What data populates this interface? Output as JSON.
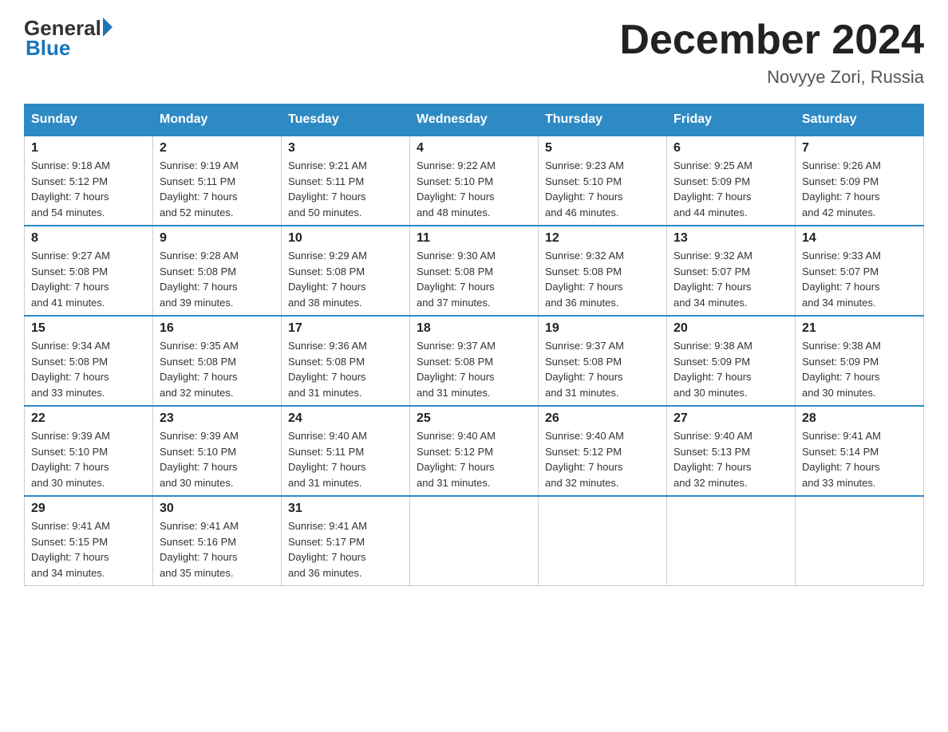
{
  "logo": {
    "general": "General",
    "blue": "Blue"
  },
  "title": "December 2024",
  "location": "Novyye Zori, Russia",
  "days_of_week": [
    "Sunday",
    "Monday",
    "Tuesday",
    "Wednesday",
    "Thursday",
    "Friday",
    "Saturday"
  ],
  "weeks": [
    [
      {
        "day": "1",
        "sunrise": "9:18 AM",
        "sunset": "5:12 PM",
        "daylight": "7 hours and 54 minutes."
      },
      {
        "day": "2",
        "sunrise": "9:19 AM",
        "sunset": "5:11 PM",
        "daylight": "7 hours and 52 minutes."
      },
      {
        "day": "3",
        "sunrise": "9:21 AM",
        "sunset": "5:11 PM",
        "daylight": "7 hours and 50 minutes."
      },
      {
        "day": "4",
        "sunrise": "9:22 AM",
        "sunset": "5:10 PM",
        "daylight": "7 hours and 48 minutes."
      },
      {
        "day": "5",
        "sunrise": "9:23 AM",
        "sunset": "5:10 PM",
        "daylight": "7 hours and 46 minutes."
      },
      {
        "day": "6",
        "sunrise": "9:25 AM",
        "sunset": "5:09 PM",
        "daylight": "7 hours and 44 minutes."
      },
      {
        "day": "7",
        "sunrise": "9:26 AM",
        "sunset": "5:09 PM",
        "daylight": "7 hours and 42 minutes."
      }
    ],
    [
      {
        "day": "8",
        "sunrise": "9:27 AM",
        "sunset": "5:08 PM",
        "daylight": "7 hours and 41 minutes."
      },
      {
        "day": "9",
        "sunrise": "9:28 AM",
        "sunset": "5:08 PM",
        "daylight": "7 hours and 39 minutes."
      },
      {
        "day": "10",
        "sunrise": "9:29 AM",
        "sunset": "5:08 PM",
        "daylight": "7 hours and 38 minutes."
      },
      {
        "day": "11",
        "sunrise": "9:30 AM",
        "sunset": "5:08 PM",
        "daylight": "7 hours and 37 minutes."
      },
      {
        "day": "12",
        "sunrise": "9:32 AM",
        "sunset": "5:08 PM",
        "daylight": "7 hours and 36 minutes."
      },
      {
        "day": "13",
        "sunrise": "9:32 AM",
        "sunset": "5:07 PM",
        "daylight": "7 hours and 34 minutes."
      },
      {
        "day": "14",
        "sunrise": "9:33 AM",
        "sunset": "5:07 PM",
        "daylight": "7 hours and 34 minutes."
      }
    ],
    [
      {
        "day": "15",
        "sunrise": "9:34 AM",
        "sunset": "5:08 PM",
        "daylight": "7 hours and 33 minutes."
      },
      {
        "day": "16",
        "sunrise": "9:35 AM",
        "sunset": "5:08 PM",
        "daylight": "7 hours and 32 minutes."
      },
      {
        "day": "17",
        "sunrise": "9:36 AM",
        "sunset": "5:08 PM",
        "daylight": "7 hours and 31 minutes."
      },
      {
        "day": "18",
        "sunrise": "9:37 AM",
        "sunset": "5:08 PM",
        "daylight": "7 hours and 31 minutes."
      },
      {
        "day": "19",
        "sunrise": "9:37 AM",
        "sunset": "5:08 PM",
        "daylight": "7 hours and 31 minutes."
      },
      {
        "day": "20",
        "sunrise": "9:38 AM",
        "sunset": "5:09 PM",
        "daylight": "7 hours and 30 minutes."
      },
      {
        "day": "21",
        "sunrise": "9:38 AM",
        "sunset": "5:09 PM",
        "daylight": "7 hours and 30 minutes."
      }
    ],
    [
      {
        "day": "22",
        "sunrise": "9:39 AM",
        "sunset": "5:10 PM",
        "daylight": "7 hours and 30 minutes."
      },
      {
        "day": "23",
        "sunrise": "9:39 AM",
        "sunset": "5:10 PM",
        "daylight": "7 hours and 30 minutes."
      },
      {
        "day": "24",
        "sunrise": "9:40 AM",
        "sunset": "5:11 PM",
        "daylight": "7 hours and 31 minutes."
      },
      {
        "day": "25",
        "sunrise": "9:40 AM",
        "sunset": "5:12 PM",
        "daylight": "7 hours and 31 minutes."
      },
      {
        "day": "26",
        "sunrise": "9:40 AM",
        "sunset": "5:12 PM",
        "daylight": "7 hours and 32 minutes."
      },
      {
        "day": "27",
        "sunrise": "9:40 AM",
        "sunset": "5:13 PM",
        "daylight": "7 hours and 32 minutes."
      },
      {
        "day": "28",
        "sunrise": "9:41 AM",
        "sunset": "5:14 PM",
        "daylight": "7 hours and 33 minutes."
      }
    ],
    [
      {
        "day": "29",
        "sunrise": "9:41 AM",
        "sunset": "5:15 PM",
        "daylight": "7 hours and 34 minutes."
      },
      {
        "day": "30",
        "sunrise": "9:41 AM",
        "sunset": "5:16 PM",
        "daylight": "7 hours and 35 minutes."
      },
      {
        "day": "31",
        "sunrise": "9:41 AM",
        "sunset": "5:17 PM",
        "daylight": "7 hours and 36 minutes."
      },
      null,
      null,
      null,
      null
    ]
  ]
}
